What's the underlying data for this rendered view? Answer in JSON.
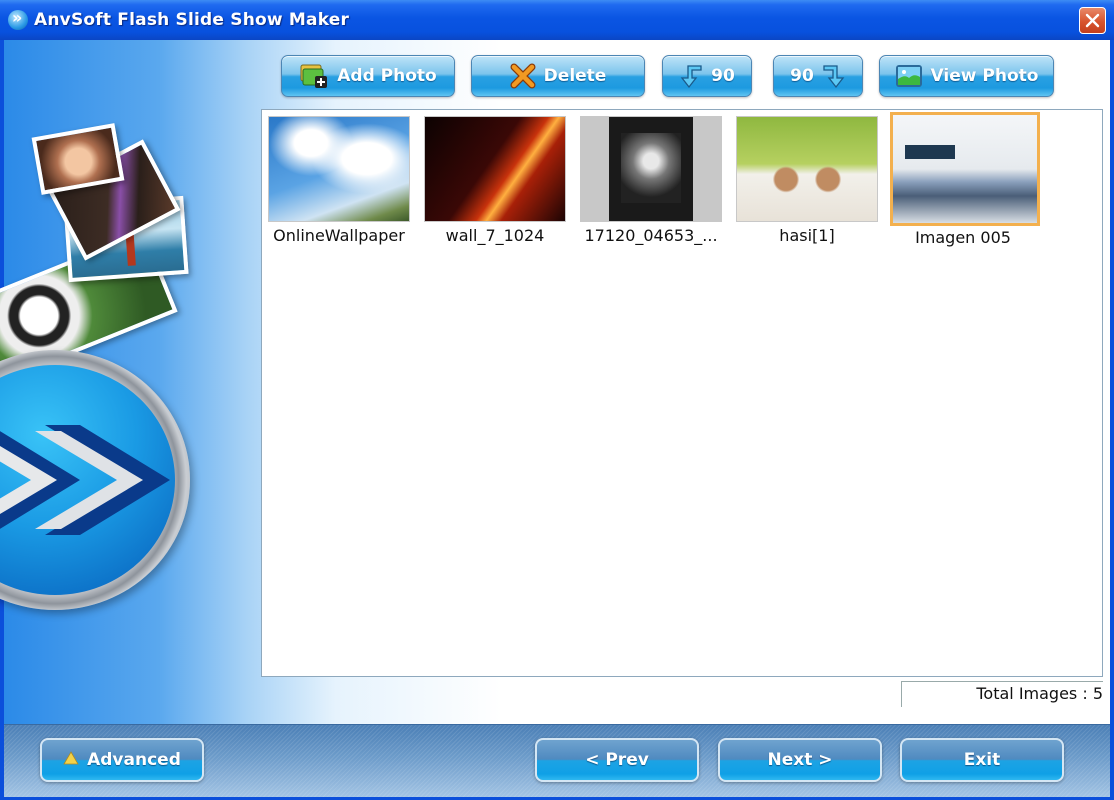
{
  "window": {
    "title": "AnvSoft Flash Slide Show Maker",
    "close_label": "Close"
  },
  "toolbar": {
    "add_photo": "Add Photo",
    "delete": "Delete",
    "rotate_left": "90",
    "rotate_right": "90",
    "view_photo": "View Photo"
  },
  "thumbnails": [
    {
      "caption": "OnlineWallpaper",
      "selected": false
    },
    {
      "caption": "wall_7_1024",
      "selected": false
    },
    {
      "caption": "17120_04653_...",
      "selected": false
    },
    {
      "caption": "hasi[1]",
      "selected": false
    },
    {
      "caption": "Imagen 005",
      "selected": true
    }
  ],
  "status": {
    "total_images": "Total Images : 5"
  },
  "footer": {
    "advanced": "Advanced",
    "prev": "< Prev",
    "next": "Next >",
    "exit": "Exit"
  },
  "colors": {
    "titlebar": "#0a55e3",
    "button_blue": "#1d9ae0",
    "selection": "#f3b04e",
    "close_red": "#d8542e"
  }
}
